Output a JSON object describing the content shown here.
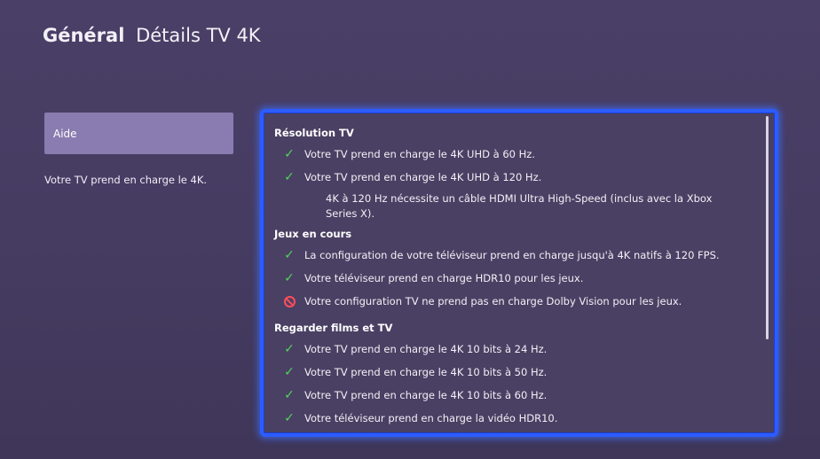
{
  "header": {
    "section": "Général",
    "title": "Détails TV 4K"
  },
  "sidebar": {
    "help_label": "Aide",
    "description": "Votre TV prend en charge le 4K."
  },
  "panel": {
    "groups": [
      {
        "title": "Résolution TV",
        "items": [
          {
            "status": "check-icon",
            "text": "Votre TV prend en charge le 4K UHD à 60 Hz."
          },
          {
            "status": "check-icon",
            "text": "Votre TV prend en charge le 4K UHD à 120 Hz."
          }
        ],
        "note": "4K à 120 Hz nécessite un câble HDMI Ultra High-Speed (inclus avec la Xbox Series X)."
      },
      {
        "title": "Jeux en cours",
        "items": [
          {
            "status": "check-icon",
            "text": "La configuration de votre téléviseur prend en charge jusqu'à 4K natifs à 120 FPS."
          },
          {
            "status": "check-icon",
            "text": "Votre téléviseur prend en charge HDR10 pour les jeux."
          },
          {
            "status": "blocked-icon",
            "text": "Votre configuration TV ne prend pas en charge Dolby Vision pour les jeux."
          }
        ]
      },
      {
        "title": "Regarder films et TV",
        "items": [
          {
            "status": "check-icon",
            "text": "Votre TV prend en charge le 4K 10 bits à 24 Hz."
          },
          {
            "status": "check-icon",
            "text": "Votre TV prend en charge le 4K 10 bits à 50 Hz."
          },
          {
            "status": "check-icon",
            "text": "Votre TV prend en charge le 4K 10 bits à 60 Hz."
          },
          {
            "status": "check-icon",
            "text": "Votre téléviseur prend en charge la vidéo HDR10."
          }
        ]
      }
    ]
  },
  "colors": {
    "accent_focus": "#2c5cff",
    "check": "#4fd45a",
    "blocked": "#ff4d5a",
    "selected": "#8a7bb0"
  }
}
